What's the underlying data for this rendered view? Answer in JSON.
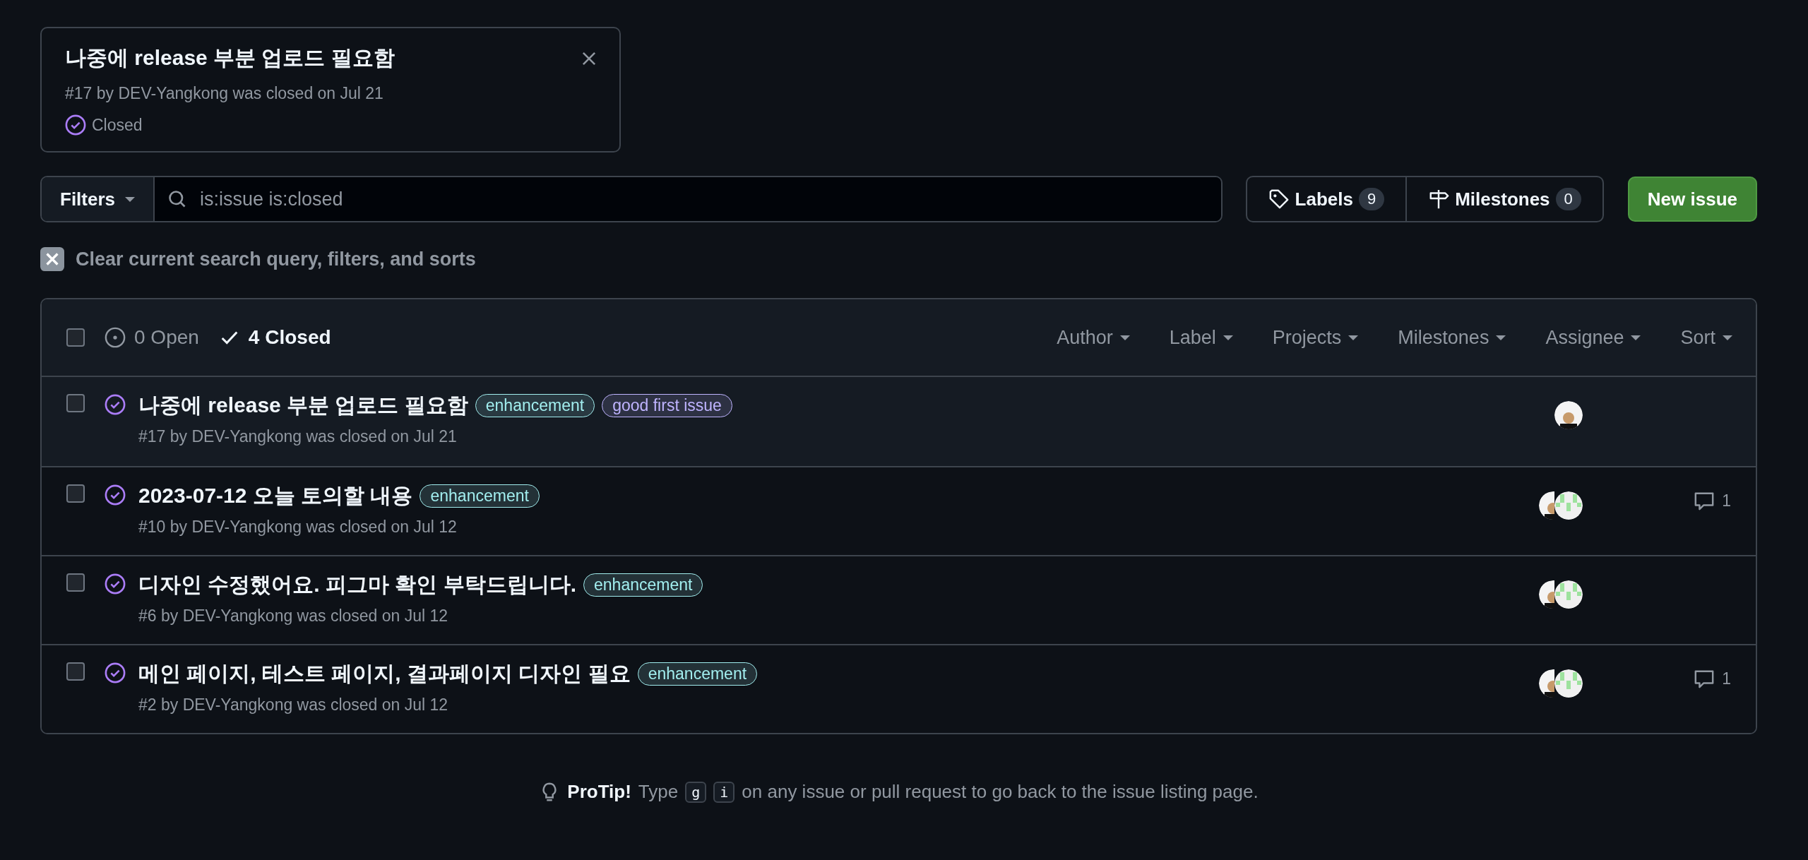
{
  "issue_card": {
    "title": "나중에 release 부분 업로드 필요함",
    "meta": "#17 by DEV-Yangkong was closed on Jul 21",
    "status": "Closed"
  },
  "filter_bar": {
    "filters_button": "Filters",
    "search": {
      "value": "is:issue is:closed"
    },
    "labels_button": {
      "label": "Labels",
      "count": "9"
    },
    "milestones_button": {
      "label": "Milestones",
      "count": "0"
    },
    "new_issue_button": "New issue"
  },
  "clear_filters": "Clear current search query, filters, and sorts",
  "table": {
    "select_all": {
      "checked": false
    },
    "state_tabs": [
      {
        "kind": "open",
        "label": "0 Open",
        "selected": false
      },
      {
        "kind": "closed",
        "label": "4 Closed",
        "selected": true
      }
    ],
    "filter_menus": [
      "Author",
      "Label",
      "Projects",
      "Milestones",
      "Assignee",
      "Sort"
    ],
    "rows": [
      {
        "title": "나중에 release 부분 업로드 필요함",
        "labels": [
          {
            "name": "enhancement",
            "color": "#a2eeef"
          },
          {
            "name": "good first issue",
            "color": "#bfb4ff"
          }
        ],
        "meta": "#17 by DEV-Yangkong was closed on Jul 21",
        "selected": true,
        "avatars": [
          {
            "kind": "cartoon"
          }
        ]
      },
      {
        "title": "2023-07-12 오늘 토의할 내용",
        "labels": [
          {
            "name": "enhancement",
            "color": "#a2eeef"
          }
        ],
        "meta": "#10 by DEV-Yangkong was closed on Jul 12",
        "selected": false,
        "avatars": [
          {
            "kind": "cartoon"
          },
          {
            "kind": "identicon"
          }
        ],
        "comments": "1"
      },
      {
        "title": "디자인 수정했어요. 피그마 확인 부탁드립니다.",
        "labels": [
          {
            "name": "enhancement",
            "color": "#a2eeef"
          }
        ],
        "meta": "#6 by DEV-Yangkong was closed on Jul 12",
        "selected": false,
        "avatars": [
          {
            "kind": "cartoon"
          },
          {
            "kind": "identicon"
          }
        ]
      },
      {
        "title": "메인 페이지, 테스트 페이지, 결과페이지 디자인 필요",
        "labels": [
          {
            "name": "enhancement",
            "color": "#a2eeef"
          }
        ],
        "meta": "#2 by DEV-Yangkong was closed on Jul 12",
        "selected": false,
        "avatars": [
          {
            "kind": "cartoon"
          },
          {
            "kind": "identicon"
          }
        ],
        "comments": "1"
      }
    ]
  },
  "protip": {
    "lead": "ProTip!",
    "before": "Type",
    "keys": [
      "g",
      "i"
    ],
    "after": "on any issue or pull request to go back to the issue listing page."
  }
}
